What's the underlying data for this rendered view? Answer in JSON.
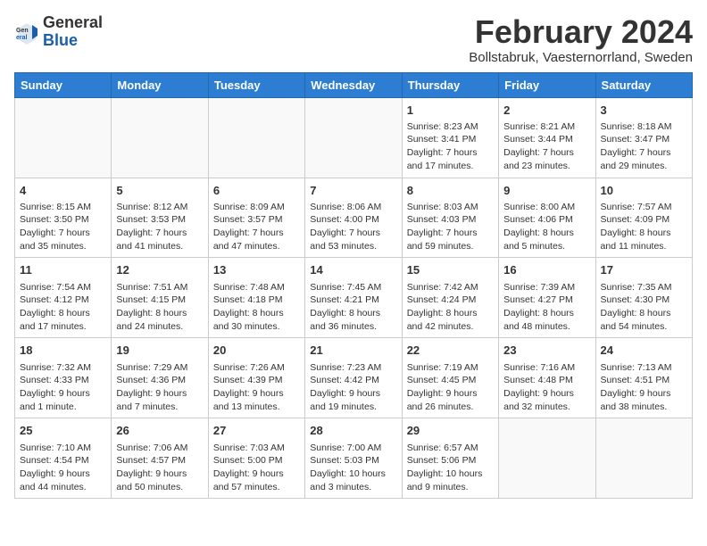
{
  "header": {
    "logo_general": "General",
    "logo_blue": "Blue",
    "month_title": "February 2024",
    "subtitle": "Bollstabruk, Vaesternorrland, Sweden"
  },
  "days_of_week": [
    "Sunday",
    "Monday",
    "Tuesday",
    "Wednesday",
    "Thursday",
    "Friday",
    "Saturday"
  ],
  "weeks": [
    [
      {
        "day": "",
        "sunrise": "",
        "sunset": "",
        "daylight": "",
        "empty": true
      },
      {
        "day": "",
        "sunrise": "",
        "sunset": "",
        "daylight": "",
        "empty": true
      },
      {
        "day": "",
        "sunrise": "",
        "sunset": "",
        "daylight": "",
        "empty": true
      },
      {
        "day": "",
        "sunrise": "",
        "sunset": "",
        "daylight": "",
        "empty": true
      },
      {
        "day": "1",
        "sunrise": "Sunrise: 8:23 AM",
        "sunset": "Sunset: 3:41 PM",
        "daylight": "Daylight: 7 hours and 17 minutes.",
        "empty": false
      },
      {
        "day": "2",
        "sunrise": "Sunrise: 8:21 AM",
        "sunset": "Sunset: 3:44 PM",
        "daylight": "Daylight: 7 hours and 23 minutes.",
        "empty": false
      },
      {
        "day": "3",
        "sunrise": "Sunrise: 8:18 AM",
        "sunset": "Sunset: 3:47 PM",
        "daylight": "Daylight: 7 hours and 29 minutes.",
        "empty": false
      }
    ],
    [
      {
        "day": "4",
        "sunrise": "Sunrise: 8:15 AM",
        "sunset": "Sunset: 3:50 PM",
        "daylight": "Daylight: 7 hours and 35 minutes.",
        "empty": false
      },
      {
        "day": "5",
        "sunrise": "Sunrise: 8:12 AM",
        "sunset": "Sunset: 3:53 PM",
        "daylight": "Daylight: 7 hours and 41 minutes.",
        "empty": false
      },
      {
        "day": "6",
        "sunrise": "Sunrise: 8:09 AM",
        "sunset": "Sunset: 3:57 PM",
        "daylight": "Daylight: 7 hours and 47 minutes.",
        "empty": false
      },
      {
        "day": "7",
        "sunrise": "Sunrise: 8:06 AM",
        "sunset": "Sunset: 4:00 PM",
        "daylight": "Daylight: 7 hours and 53 minutes.",
        "empty": false
      },
      {
        "day": "8",
        "sunrise": "Sunrise: 8:03 AM",
        "sunset": "Sunset: 4:03 PM",
        "daylight": "Daylight: 7 hours and 59 minutes.",
        "empty": false
      },
      {
        "day": "9",
        "sunrise": "Sunrise: 8:00 AM",
        "sunset": "Sunset: 4:06 PM",
        "daylight": "Daylight: 8 hours and 5 minutes.",
        "empty": false
      },
      {
        "day": "10",
        "sunrise": "Sunrise: 7:57 AM",
        "sunset": "Sunset: 4:09 PM",
        "daylight": "Daylight: 8 hours and 11 minutes.",
        "empty": false
      }
    ],
    [
      {
        "day": "11",
        "sunrise": "Sunrise: 7:54 AM",
        "sunset": "Sunset: 4:12 PM",
        "daylight": "Daylight: 8 hours and 17 minutes.",
        "empty": false
      },
      {
        "day": "12",
        "sunrise": "Sunrise: 7:51 AM",
        "sunset": "Sunset: 4:15 PM",
        "daylight": "Daylight: 8 hours and 24 minutes.",
        "empty": false
      },
      {
        "day": "13",
        "sunrise": "Sunrise: 7:48 AM",
        "sunset": "Sunset: 4:18 PM",
        "daylight": "Daylight: 8 hours and 30 minutes.",
        "empty": false
      },
      {
        "day": "14",
        "sunrise": "Sunrise: 7:45 AM",
        "sunset": "Sunset: 4:21 PM",
        "daylight": "Daylight: 8 hours and 36 minutes.",
        "empty": false
      },
      {
        "day": "15",
        "sunrise": "Sunrise: 7:42 AM",
        "sunset": "Sunset: 4:24 PM",
        "daylight": "Daylight: 8 hours and 42 minutes.",
        "empty": false
      },
      {
        "day": "16",
        "sunrise": "Sunrise: 7:39 AM",
        "sunset": "Sunset: 4:27 PM",
        "daylight": "Daylight: 8 hours and 48 minutes.",
        "empty": false
      },
      {
        "day": "17",
        "sunrise": "Sunrise: 7:35 AM",
        "sunset": "Sunset: 4:30 PM",
        "daylight": "Daylight: 8 hours and 54 minutes.",
        "empty": false
      }
    ],
    [
      {
        "day": "18",
        "sunrise": "Sunrise: 7:32 AM",
        "sunset": "Sunset: 4:33 PM",
        "daylight": "Daylight: 9 hours and 1 minute.",
        "empty": false
      },
      {
        "day": "19",
        "sunrise": "Sunrise: 7:29 AM",
        "sunset": "Sunset: 4:36 PM",
        "daylight": "Daylight: 9 hours and 7 minutes.",
        "empty": false
      },
      {
        "day": "20",
        "sunrise": "Sunrise: 7:26 AM",
        "sunset": "Sunset: 4:39 PM",
        "daylight": "Daylight: 9 hours and 13 minutes.",
        "empty": false
      },
      {
        "day": "21",
        "sunrise": "Sunrise: 7:23 AM",
        "sunset": "Sunset: 4:42 PM",
        "daylight": "Daylight: 9 hours and 19 minutes.",
        "empty": false
      },
      {
        "day": "22",
        "sunrise": "Sunrise: 7:19 AM",
        "sunset": "Sunset: 4:45 PM",
        "daylight": "Daylight: 9 hours and 26 minutes.",
        "empty": false
      },
      {
        "day": "23",
        "sunrise": "Sunrise: 7:16 AM",
        "sunset": "Sunset: 4:48 PM",
        "daylight": "Daylight: 9 hours and 32 minutes.",
        "empty": false
      },
      {
        "day": "24",
        "sunrise": "Sunrise: 7:13 AM",
        "sunset": "Sunset: 4:51 PM",
        "daylight": "Daylight: 9 hours and 38 minutes.",
        "empty": false
      }
    ],
    [
      {
        "day": "25",
        "sunrise": "Sunrise: 7:10 AM",
        "sunset": "Sunset: 4:54 PM",
        "daylight": "Daylight: 9 hours and 44 minutes.",
        "empty": false
      },
      {
        "day": "26",
        "sunrise": "Sunrise: 7:06 AM",
        "sunset": "Sunset: 4:57 PM",
        "daylight": "Daylight: 9 hours and 50 minutes.",
        "empty": false
      },
      {
        "day": "27",
        "sunrise": "Sunrise: 7:03 AM",
        "sunset": "Sunset: 5:00 PM",
        "daylight": "Daylight: 9 hours and 57 minutes.",
        "empty": false
      },
      {
        "day": "28",
        "sunrise": "Sunrise: 7:00 AM",
        "sunset": "Sunset: 5:03 PM",
        "daylight": "Daylight: 10 hours and 3 minutes.",
        "empty": false
      },
      {
        "day": "29",
        "sunrise": "Sunrise: 6:57 AM",
        "sunset": "Sunset: 5:06 PM",
        "daylight": "Daylight: 10 hours and 9 minutes.",
        "empty": false
      },
      {
        "day": "",
        "sunrise": "",
        "sunset": "",
        "daylight": "",
        "empty": true
      },
      {
        "day": "",
        "sunrise": "",
        "sunset": "",
        "daylight": "",
        "empty": true
      }
    ]
  ]
}
